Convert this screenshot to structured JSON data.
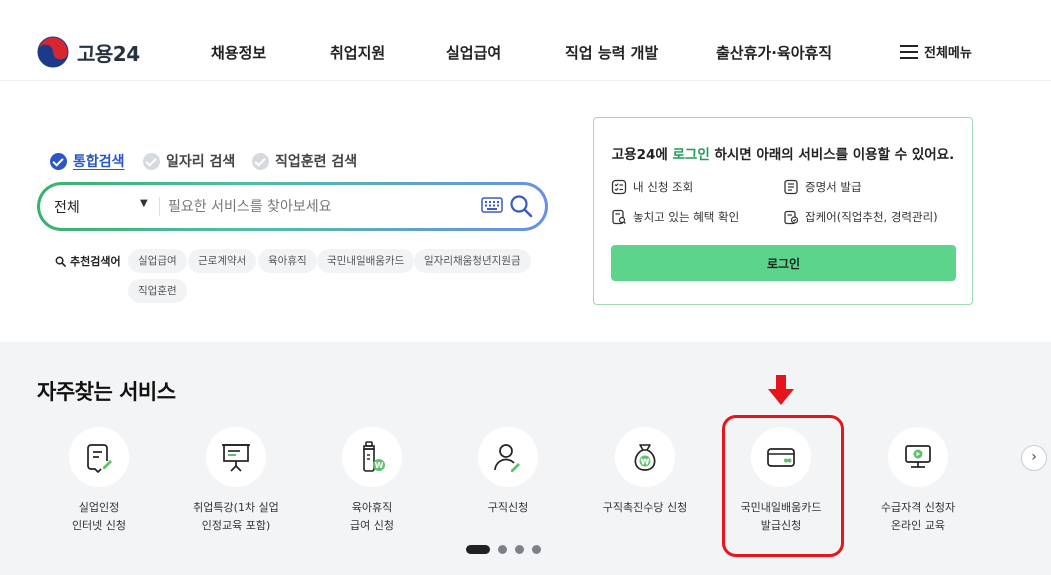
{
  "header": {
    "logo_text": "고용24",
    "nav": [
      "채용정보",
      "취업지원",
      "실업급여",
      "직업 능력 개발",
      "출산휴가·육아휴직"
    ],
    "all_menu": "전체메뉴"
  },
  "search": {
    "tabs": [
      {
        "label": "통합검색",
        "active": true
      },
      {
        "label": "일자리 검색",
        "active": false
      },
      {
        "label": "직업훈련 검색",
        "active": false
      }
    ],
    "select_value": "전체",
    "placeholder": "필요한 서비스를 찾아보세요",
    "rec_label": "추천검색어",
    "keywords": [
      "실업급여",
      "근로계약서",
      "육아휴직",
      "국민내일배움카드",
      "일자리채움청년지원금",
      "직업훈련"
    ]
  },
  "login": {
    "msg_pre": "고용24에 ",
    "msg_hl": "로그인",
    "msg_post": " 하시면 아래의 서비스를 이용할 수 있어요.",
    "items": [
      "내 신청 조회",
      "증명서 발급",
      "놓치고 있는 혜택 확인",
      "잡케어(직업추천, 경력관리)"
    ],
    "button": "로그인"
  },
  "services": {
    "title": "자주찾는 서비스",
    "items": [
      {
        "label": "실업인정\n인터넷 신청",
        "icon": "document-pen-icon"
      },
      {
        "label": "취업특강(1차 실업\n인정교육 포함)",
        "icon": "presentation-board-icon"
      },
      {
        "label": "육아휴직\n급여 신청",
        "icon": "baby-bottle-icon"
      },
      {
        "label": "구직신청",
        "icon": "person-pen-icon"
      },
      {
        "label": "구직촉진수당 신청",
        "icon": "money-bag-icon"
      },
      {
        "label": "국민내일배움카드\n발급신청",
        "icon": "card-icon"
      },
      {
        "label": "수급자격 신청자\n온라인 교육",
        "icon": "online-education-icon"
      }
    ],
    "highlighted_index": 5,
    "highlight_color": "#e8141b",
    "pagination": {
      "total": 4,
      "current": 1
    }
  },
  "colors": {
    "accent_blue": "#2a56c6",
    "accent_green": "#1f9c55",
    "login_button": "#5cd48c"
  }
}
